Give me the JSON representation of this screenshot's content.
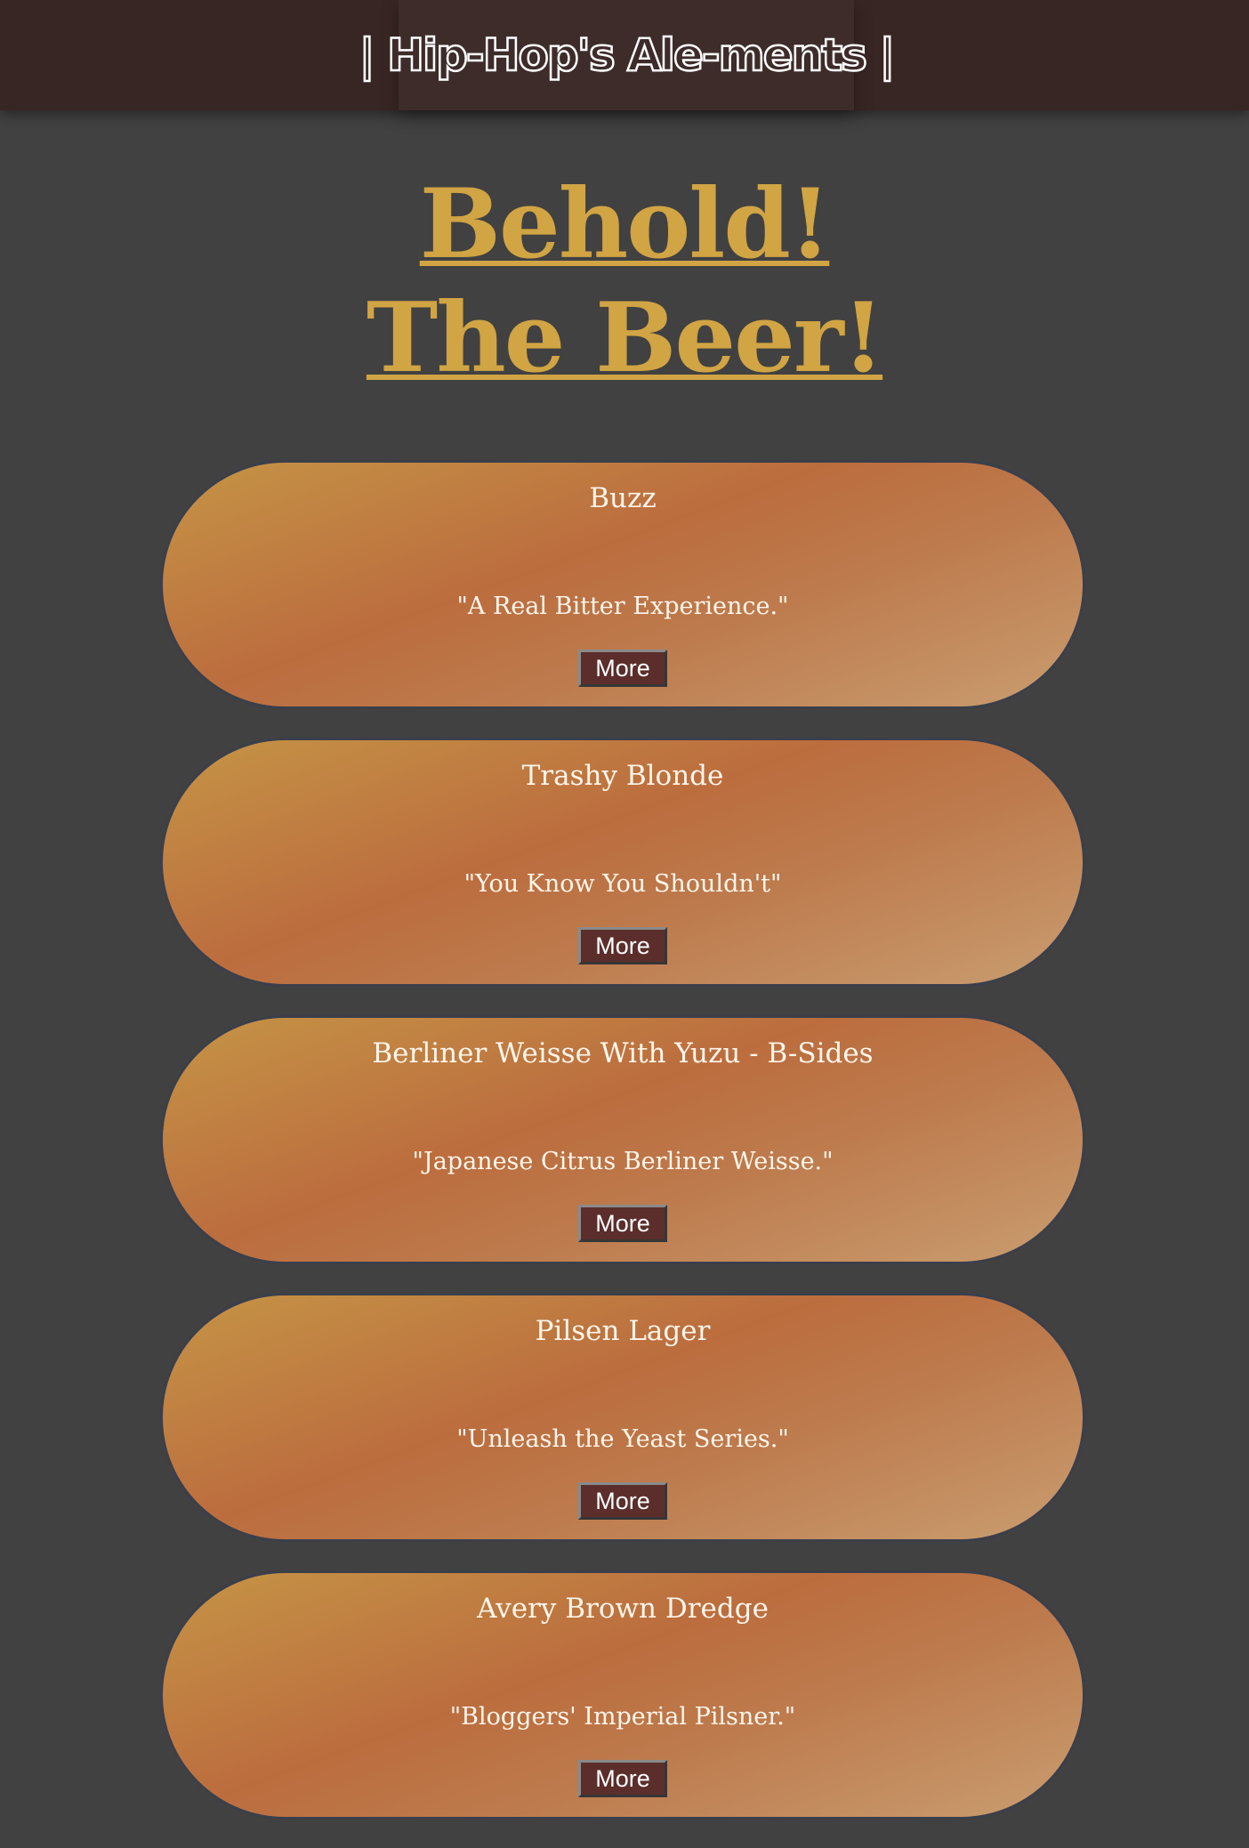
{
  "header": {
    "brand": "| Hip-Hop's Ale-ments |"
  },
  "hero": {
    "line1": "Behold!",
    "line2": "The Beer!"
  },
  "beers": [
    {
      "name": "Buzz",
      "tagline": "\"A Real Bitter Experience.\"",
      "button": "More"
    },
    {
      "name": "Trashy Blonde",
      "tagline": "\"You Know You Shouldn't\"",
      "button": "More"
    },
    {
      "name": "Berliner Weisse With Yuzu - B-Sides",
      "tagline": "\"Japanese Citrus Berliner Weisse.\"",
      "button": "More"
    },
    {
      "name": "Pilsen Lager",
      "tagline": "\"Unleash the Yeast Series.\"",
      "button": "More"
    },
    {
      "name": "Avery Brown Dredge",
      "tagline": "\"Bloggers' Imperial Pilsner.\"",
      "button": "More"
    }
  ],
  "colors": {
    "background": "#414141",
    "header": "#382624",
    "accent": "#d1a444",
    "button": "#5b2e2b"
  }
}
